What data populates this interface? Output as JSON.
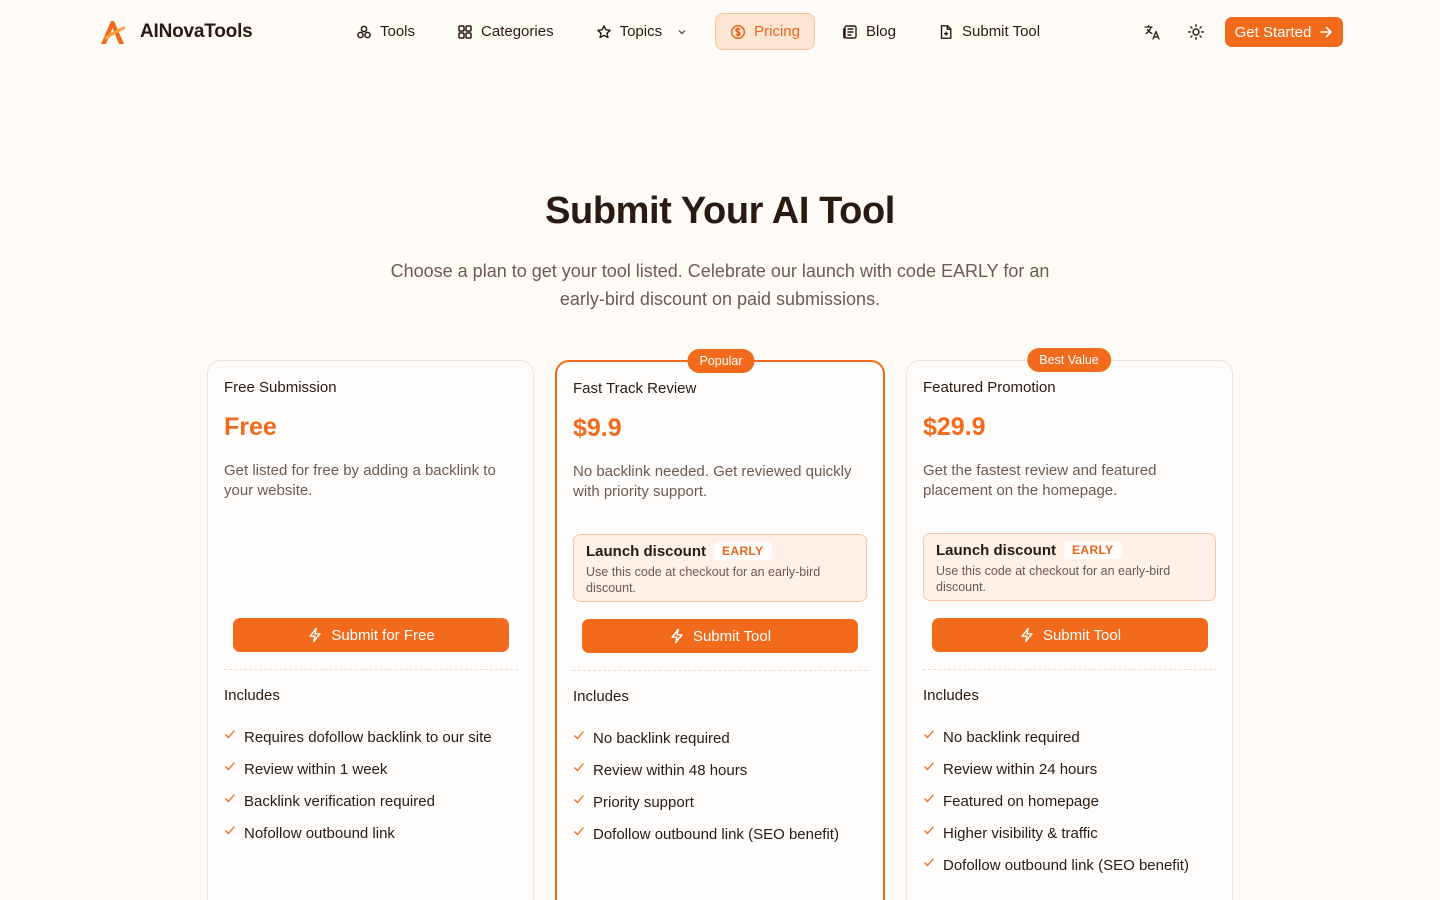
{
  "brand": {
    "name": "AINovaTools",
    "accent": "#f26a1b"
  },
  "nav": {
    "items": [
      {
        "label": "Tools",
        "icon": "toolkit-icon",
        "active": false
      },
      {
        "label": "Categories",
        "icon": "grid-icon",
        "active": false
      },
      {
        "label": "Topics",
        "icon": "star-icon",
        "active": false,
        "dropdown": true
      },
      {
        "label": "Pricing",
        "icon": "dollar-circle-icon",
        "active": true
      },
      {
        "label": "Blog",
        "icon": "newspaper-icon",
        "active": false
      },
      {
        "label": "Submit Tool",
        "icon": "file-plus-icon",
        "active": false
      }
    ]
  },
  "header_actions": {
    "language_icon": "translate-icon",
    "theme_icon": "sun-icon",
    "cta_label": "Get Started"
  },
  "hero": {
    "title": "Submit Your AI Tool",
    "subtitle": "Choose a plan to get your tool listed. Celebrate our launch with code EARLY for an early-bird discount on paid submissions."
  },
  "plans": [
    {
      "name": "Free Submission",
      "price": "Free",
      "description": "Get listed for free by adding a backlink to your website.",
      "badge": null,
      "discount": null,
      "button": "Submit for Free",
      "includes_label": "Includes",
      "features": [
        "Requires dofollow backlink to our site",
        "Review within 1 week",
        "Backlink verification required",
        "Nofollow outbound link"
      ]
    },
    {
      "name": "Fast Track Review",
      "price": "$9.9",
      "description": "No backlink needed. Get reviewed quickly with priority support.",
      "badge": "Popular",
      "discount": {
        "title": "Launch discount",
        "code": "EARLY",
        "text": "Use this code at checkout for an early-bird discount."
      },
      "button": "Submit Tool",
      "includes_label": "Includes",
      "features": [
        "No backlink required",
        "Review within 48 hours",
        "Priority support",
        "Dofollow outbound link (SEO benefit)"
      ]
    },
    {
      "name": "Featured Promotion",
      "price": "$29.9",
      "description": "Get the fastest review and featured placement on the homepage.",
      "badge": "Best Value",
      "discount": {
        "title": "Launch discount",
        "code": "EARLY",
        "text": "Use this code at checkout for an early-bird discount."
      },
      "button": "Submit Tool",
      "includes_label": "Includes",
      "features": [
        "No backlink required",
        "Review within 24 hours",
        "Featured on homepage",
        "Higher visibility & traffic",
        "Dofollow outbound link (SEO benefit)"
      ]
    }
  ]
}
